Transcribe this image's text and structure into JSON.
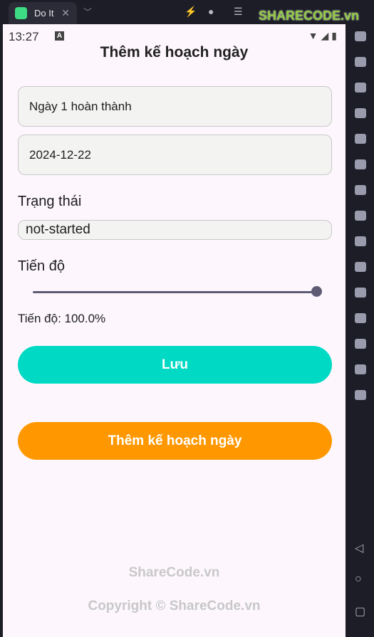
{
  "window": {
    "tab_title": "Do It",
    "brand": "SHARECODE.vn"
  },
  "status": {
    "time": "13:27",
    "badge": "A"
  },
  "page": {
    "title": "Thêm kế hoạch ngày"
  },
  "form": {
    "title_value": "Ngày 1 hoàn thành",
    "date_value": "2024-12-22",
    "status_label": "Trạng thái",
    "status_value": "not-started",
    "progress_label": "Tiến độ",
    "progress_percent": 100,
    "progress_text": "Tiến độ: 100.0%",
    "save_label": "Lưu",
    "add_label": "Thêm kế hoạch ngày"
  },
  "colors": {
    "save": "#00d9c4",
    "add": "#ff9800",
    "slider": "#5f5a75"
  },
  "watermark": {
    "line1": "ShareCode.vn",
    "line2": "Copyright © ShareCode.vn"
  },
  "sidebar_icons": [
    "settings-icon",
    "keyboard-icon",
    "volume-up-icon",
    "volume-down-icon",
    "screenshot-icon",
    "record-icon",
    "multi-instance-icon",
    "install-apk-icon",
    "cut-icon",
    "video-icon",
    "sync-icon",
    "rotate-icon",
    "folder-icon",
    "location-icon",
    "resize-icon"
  ]
}
